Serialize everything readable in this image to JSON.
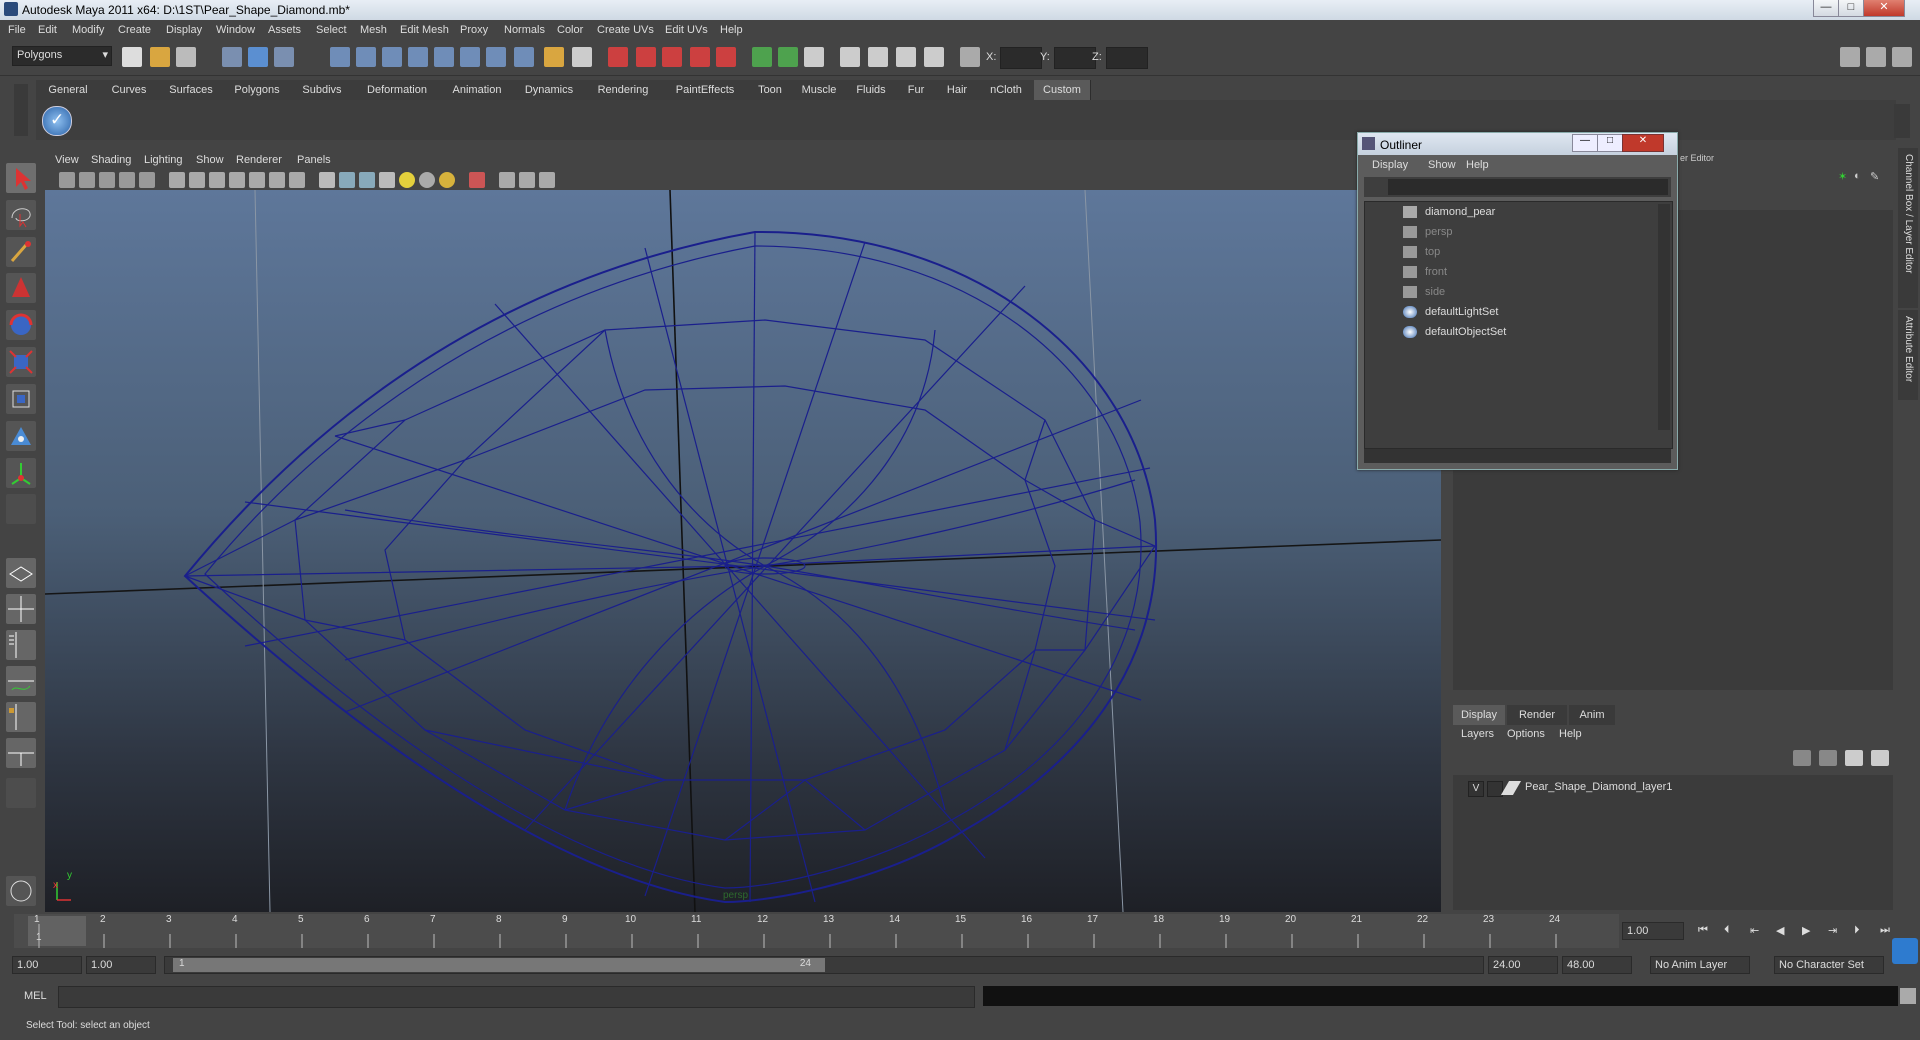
{
  "window": {
    "title": "Autodesk Maya 2011 x64: D:\\1ST\\Pear_Shape_Diamond.mb*",
    "minimize": "—",
    "maximize": "□",
    "close": "✕"
  },
  "menubar": [
    "File",
    "Edit",
    "Modify",
    "Create",
    "Display",
    "Window",
    "Assets",
    "Select",
    "Mesh",
    "Edit Mesh",
    "Proxy",
    "Normals",
    "Color",
    "Create UVs",
    "Edit UVs",
    "Help"
  ],
  "statusline": {
    "mode": "Polygons",
    "x_label": "X:",
    "y_label": "Y:",
    "z_label": "Z:"
  },
  "shelf_tabs": [
    "General",
    "Curves",
    "Surfaces",
    "Polygons",
    "Subdivs",
    "Deformation",
    "Animation",
    "Dynamics",
    "Rendering",
    "PaintEffects",
    "Toon",
    "Muscle",
    "Fluids",
    "Fur",
    "Hair",
    "nCloth",
    "Custom"
  ],
  "shelf_active": "Custom",
  "viewport": {
    "menu": [
      "View",
      "Shading",
      "Lighting",
      "Show",
      "Renderer",
      "Panels"
    ],
    "camera_label": "persp",
    "axis_x": "x",
    "axis_y": "y"
  },
  "outliner": {
    "title": "Outliner",
    "menu": [
      "Display",
      "Show",
      "Help"
    ],
    "items": [
      {
        "label": "diamond_pear",
        "dim": false,
        "icon": "mesh-icon"
      },
      {
        "label": "persp",
        "dim": true,
        "icon": "camera-icon"
      },
      {
        "label": "top",
        "dim": true,
        "icon": "camera-icon"
      },
      {
        "label": "front",
        "dim": true,
        "icon": "camera-icon"
      },
      {
        "label": "side",
        "dim": true,
        "icon": "camera-icon"
      },
      {
        "label": "defaultLightSet",
        "dim": false,
        "icon": "set-icon"
      },
      {
        "label": "defaultObjectSet",
        "dim": false,
        "icon": "set-icon"
      }
    ]
  },
  "right_panel": {
    "side_tab_1": "Channel Box / Layer Editor",
    "side_tab_2": "Attribute Editor",
    "partial_label": "er Editor"
  },
  "layer_editor": {
    "tabs": [
      "Display",
      "Render",
      "Anim"
    ],
    "menu": [
      "Layers",
      "Options",
      "Help"
    ],
    "layer": {
      "visibility": "V",
      "name": "Pear_Shape_Diamond_layer1"
    }
  },
  "timeslider": {
    "ticks": [
      "1",
      "2",
      "3",
      "4",
      "5",
      "6",
      "7",
      "8",
      "9",
      "10",
      "11",
      "12",
      "13",
      "14",
      "15",
      "16",
      "17",
      "18",
      "19",
      "20",
      "21",
      "22",
      "23",
      "24"
    ],
    "current_frame_marker": "1",
    "current_time": "1.00"
  },
  "rangebar": {
    "start": "1.00",
    "playback_start": "1.00",
    "range_start_label": "1",
    "range_end_label": "24",
    "playback_end": "24.00",
    "end": "48.00",
    "anim_layer": "No Anim Layer",
    "char_set": "No Character Set"
  },
  "mel": {
    "label": "MEL"
  },
  "help_line": "Select Tool: select an object"
}
